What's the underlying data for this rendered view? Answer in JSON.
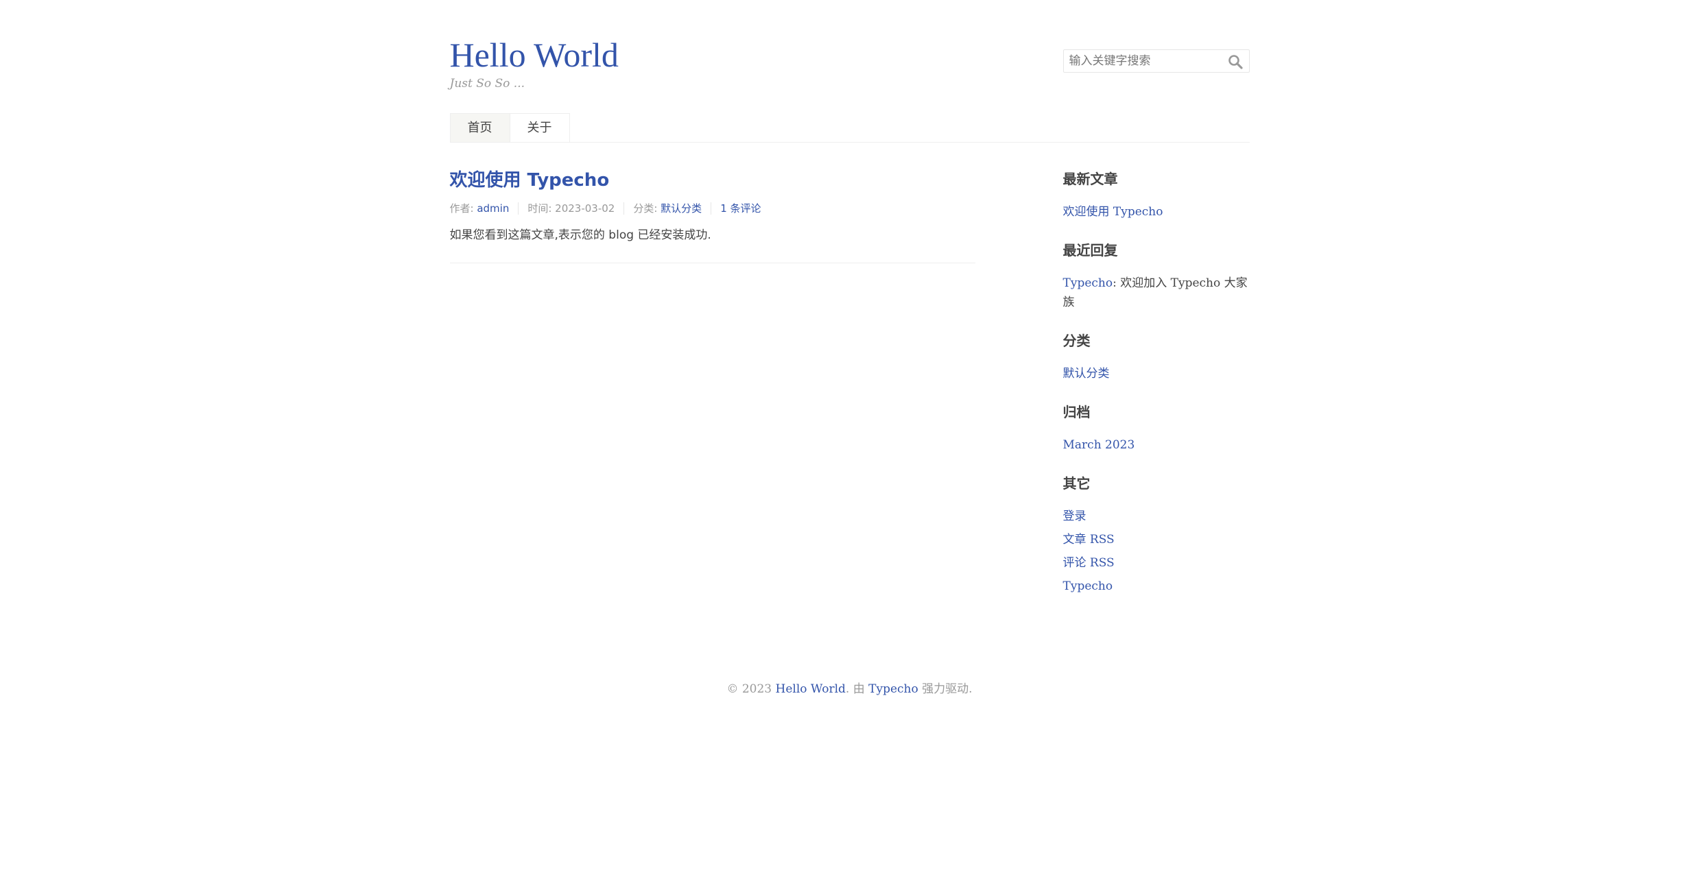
{
  "site": {
    "title": "Hello World",
    "description": "Just So So ..."
  },
  "search": {
    "placeholder": "输入关键字搜索",
    "icon": "search-icon"
  },
  "nav": {
    "items": [
      {
        "label": "首页",
        "active": true
      },
      {
        "label": "关于",
        "active": false
      }
    ]
  },
  "post": {
    "title": "欢迎使用 Typecho",
    "meta": {
      "author_label": "作者: ",
      "author": "admin",
      "time_label": "时间: ",
      "time": "2023-03-02",
      "category_label": "分类: ",
      "category": "默认分类",
      "comments": "1 条评论"
    },
    "content": "如果您看到这篇文章,表示您的 blog 已经安装成功."
  },
  "sidebar": {
    "recent_posts": {
      "title": "最新文章",
      "items": [
        "欢迎使用 Typecho"
      ]
    },
    "recent_comments": {
      "title": "最近回复",
      "items": [
        {
          "author": "Typecho",
          "separator": ": ",
          "text": "欢迎加入 Typecho 大家族"
        }
      ]
    },
    "categories": {
      "title": "分类",
      "items": [
        "默认分类"
      ]
    },
    "archives": {
      "title": "归档",
      "items": [
        "March 2023"
      ]
    },
    "other": {
      "title": "其它",
      "items": [
        "登录",
        "文章 RSS",
        "评论 RSS",
        "Typecho"
      ]
    }
  },
  "footer": {
    "copyright": "© 2023 ",
    "site_link": "Hello World",
    "powered_prefix": ". 由 ",
    "powered_link": "Typecho",
    "powered_suffix": " 强力驱动."
  },
  "colors": {
    "link": "#3354AA",
    "text": "#444444",
    "muted": "#999999",
    "border": "#EEEEEE",
    "nav_active_bg": "#F6F6F3"
  }
}
